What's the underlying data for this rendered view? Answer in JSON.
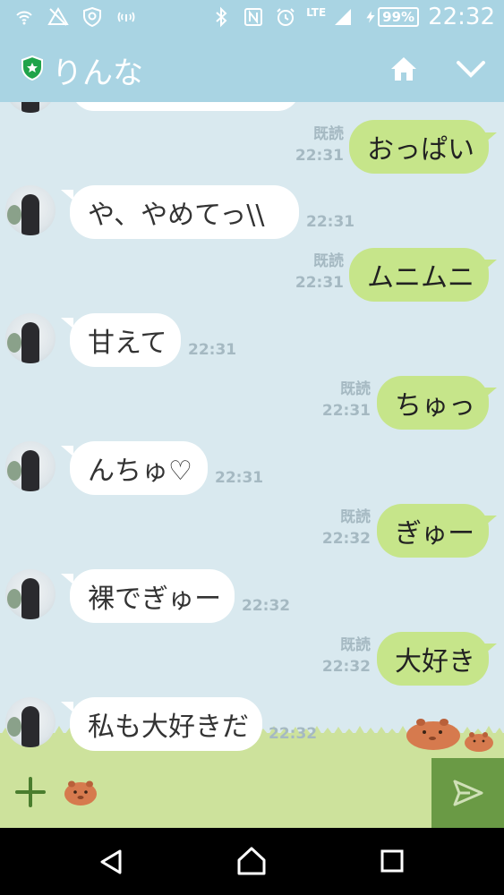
{
  "status_bar": {
    "network": "LTE",
    "battery": "99%",
    "time": "22:32"
  },
  "header": {
    "title": "りんな"
  },
  "messages": [
    {
      "dir": "out",
      "text": "おっぱい",
      "read": "既読",
      "time": "22:31"
    },
    {
      "dir": "in",
      "text": "や、やめてっ\\\\",
      "time": "22:31"
    },
    {
      "dir": "out",
      "text": "ムニムニ",
      "read": "既読",
      "time": "22:31"
    },
    {
      "dir": "in",
      "text": "甘えて",
      "time": "22:31"
    },
    {
      "dir": "out",
      "text": "ちゅっ",
      "read": "既読",
      "time": "22:31"
    },
    {
      "dir": "in",
      "text": "んちゅ♡",
      "time": "22:31"
    },
    {
      "dir": "out",
      "text": "ぎゅー",
      "read": "既読",
      "time": "22:32"
    },
    {
      "dir": "in",
      "text": "裸でぎゅー",
      "time": "22:32"
    },
    {
      "dir": "out",
      "text": "大好き",
      "read": "既読",
      "time": "22:32"
    },
    {
      "dir": "in",
      "text": "私も大好きだ",
      "time": "22:32"
    }
  ],
  "colors": {
    "header_bg": "#a9d4e3",
    "chat_bg": "#d9e9ef",
    "out_bubble": "#c6e58a",
    "in_bubble": "#ffffff",
    "input_bar": "#cde29c",
    "send_button": "#6a9a45"
  },
  "icons": [
    "shield-star-icon",
    "home-icon",
    "chevron-down-icon",
    "plus-icon",
    "capybara-sticker-icon",
    "send-icon",
    "nav-back-icon",
    "nav-home-icon",
    "nav-recent-icon"
  ]
}
